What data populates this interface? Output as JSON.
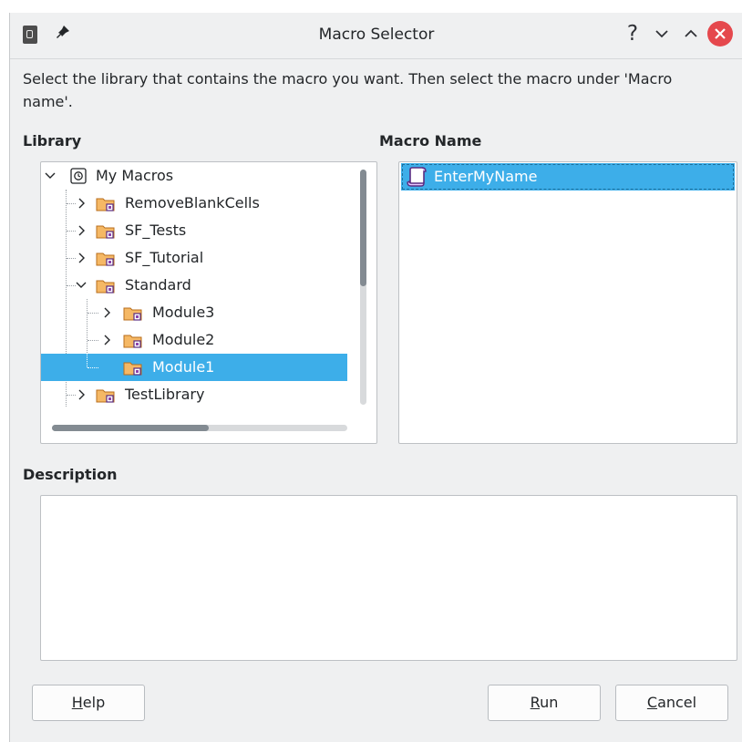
{
  "window": {
    "title": "Macro Selector",
    "help_glyph": "?"
  },
  "intro": "Select the library that contains the macro you want. Then select the macro under 'Macro name'.",
  "library": {
    "label": "Library",
    "root": {
      "label": "My Macros",
      "expanded": true
    },
    "items": [
      {
        "label": "RemoveBlankCells",
        "expanded": false
      },
      {
        "label": "SF_Tests",
        "expanded": false
      },
      {
        "label": "SF_Tutorial",
        "expanded": false
      },
      {
        "label": "Standard",
        "expanded": true
      },
      {
        "label": "Module3",
        "expanded": false
      },
      {
        "label": "Module2",
        "expanded": false
      },
      {
        "label": "Module1",
        "selected": true
      },
      {
        "label": "TestLibrary",
        "expanded": false
      }
    ]
  },
  "macros": {
    "label": "Macro Name",
    "items": [
      {
        "label": "EnterMyName",
        "selected": true
      }
    ]
  },
  "description": {
    "label": "Description",
    "value": ""
  },
  "buttons": {
    "help": {
      "mnemonic": "H",
      "rest": "elp"
    },
    "run": {
      "mnemonic": "R",
      "rest": "un"
    },
    "cancel": {
      "mnemonic": "C",
      "rest": "ancel"
    }
  },
  "colors": {
    "selection": "#3daee9",
    "dialog_bg": "#eff0f1",
    "folder": "#f0a74a",
    "close": "#e5484d"
  },
  "icons": {
    "root": "macro-library-icon",
    "folder": "folder-macro-icon",
    "macro": "macro-scroll-icon"
  }
}
